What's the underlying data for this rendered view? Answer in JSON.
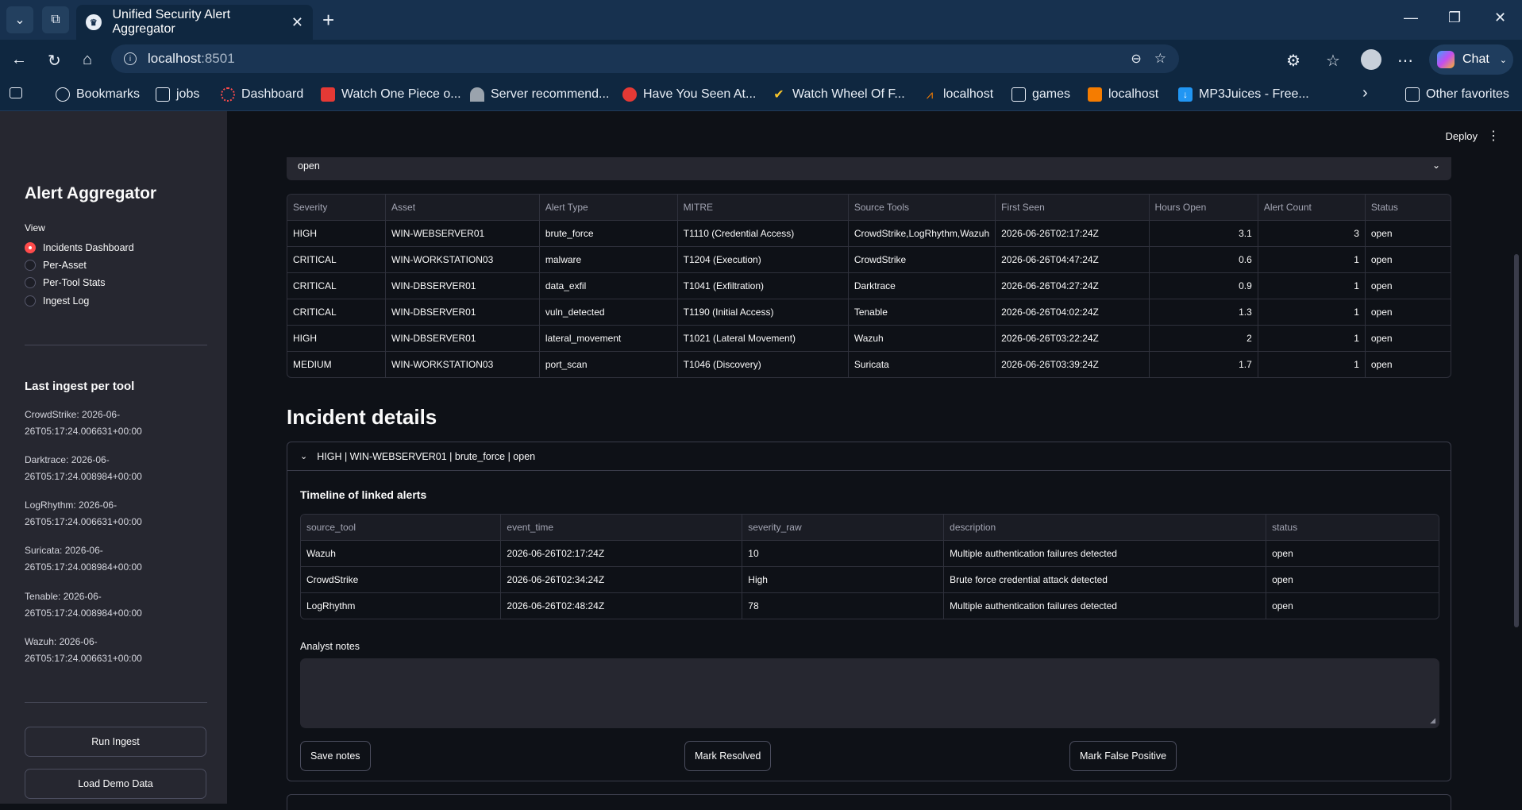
{
  "browser": {
    "tab_title": "Unified Security Alert Aggregator",
    "url_host": "localhost",
    "url_port": ":8501",
    "chat_label": "Chat",
    "bookmarks": [
      "Bookmarks",
      "jobs",
      "Dashboard",
      "Watch One Piece o...",
      "Server recommend...",
      "Have You Seen At...",
      "Watch Wheel Of F...",
      "localhost",
      "games",
      "localhost",
      "MP3Juices - Free...",
      "Other favorites"
    ]
  },
  "sidebar": {
    "title": "Alert Aggregator",
    "view_label": "View",
    "views": [
      "Incidents Dashboard",
      "Per-Asset",
      "Per-Tool Stats",
      "Ingest Log"
    ],
    "selected_view": "Incidents Dashboard",
    "last_ingest_title": "Last ingest per tool",
    "ingest": [
      {
        "tool": "CrowdStrike",
        "time_a": "2026-06-",
        "time_b": "26T05:17:24.006631+00:00"
      },
      {
        "tool": "Darktrace",
        "time_a": "2026-06-",
        "time_b": "26T05:17:24.008984+00:00"
      },
      {
        "tool": "LogRhythm",
        "time_a": "2026-06-",
        "time_b": "26T05:17:24.006631+00:00"
      },
      {
        "tool": "Suricata",
        "time_a": "2026-06-",
        "time_b": "26T05:17:24.008984+00:00"
      },
      {
        "tool": "Tenable",
        "time_a": "2026-06-",
        "time_b": "26T05:17:24.008984+00:00"
      },
      {
        "tool": "Wazuh",
        "time_a": "2026-06-",
        "time_b": "26T05:17:24.006631+00:00"
      }
    ],
    "run_ingest": "Run Ingest",
    "load_demo": "Load Demo Data"
  },
  "main": {
    "deploy": "Deploy",
    "status_filter": "open",
    "incidents": {
      "columns": [
        "Severity",
        "Asset",
        "Alert Type",
        "MITRE",
        "Source Tools",
        "First Seen",
        "Hours Open",
        "Alert Count",
        "Status"
      ],
      "rows": [
        [
          "HIGH",
          "WIN-WEBSERVER01",
          "brute_force",
          "T1110 (Credential Access)",
          "CrowdStrike,LogRhythm,Wazuh",
          "2026-06-26T02:17:24Z",
          "3.1",
          "3",
          "open"
        ],
        [
          "CRITICAL",
          "WIN-WORKSTATION03",
          "malware",
          "T1204 (Execution)",
          "CrowdStrike",
          "2026-06-26T04:47:24Z",
          "0.6",
          "1",
          "open"
        ],
        [
          "CRITICAL",
          "WIN-DBSERVER01",
          "data_exfil",
          "T1041 (Exfiltration)",
          "Darktrace",
          "2026-06-26T04:27:24Z",
          "0.9",
          "1",
          "open"
        ],
        [
          "CRITICAL",
          "WIN-DBSERVER01",
          "vuln_detected",
          "T1190 (Initial Access)",
          "Tenable",
          "2026-06-26T04:02:24Z",
          "1.3",
          "1",
          "open"
        ],
        [
          "HIGH",
          "WIN-DBSERVER01",
          "lateral_movement",
          "T1021 (Lateral Movement)",
          "Wazuh",
          "2026-06-26T03:22:24Z",
          "2",
          "1",
          "open"
        ],
        [
          "MEDIUM",
          "WIN-WORKSTATION03",
          "port_scan",
          "T1046 (Discovery)",
          "Suricata",
          "2026-06-26T03:39:24Z",
          "1.7",
          "1",
          "open"
        ]
      ]
    },
    "details_title": "Incident details",
    "expander_label": "HIGH | WIN-WEBSERVER01 | brute_force | open",
    "timeline_title": "Timeline of linked alerts",
    "timeline": {
      "columns": [
        "source_tool",
        "event_time",
        "severity_raw",
        "description",
        "status"
      ],
      "rows": [
        [
          "Wazuh",
          "2026-06-26T02:17:24Z",
          "10",
          "Multiple authentication failures detected",
          "open"
        ],
        [
          "CrowdStrike",
          "2026-06-26T02:34:24Z",
          "High",
          "Brute force credential attack detected",
          "open"
        ],
        [
          "LogRhythm",
          "2026-06-26T02:48:24Z",
          "78",
          "Multiple authentication failures detected",
          "open"
        ]
      ]
    },
    "notes_label": "Analyst notes",
    "notes_value": "",
    "save_notes": "Save notes",
    "mark_resolved": "Mark Resolved",
    "mark_fp": "Mark False Positive"
  }
}
